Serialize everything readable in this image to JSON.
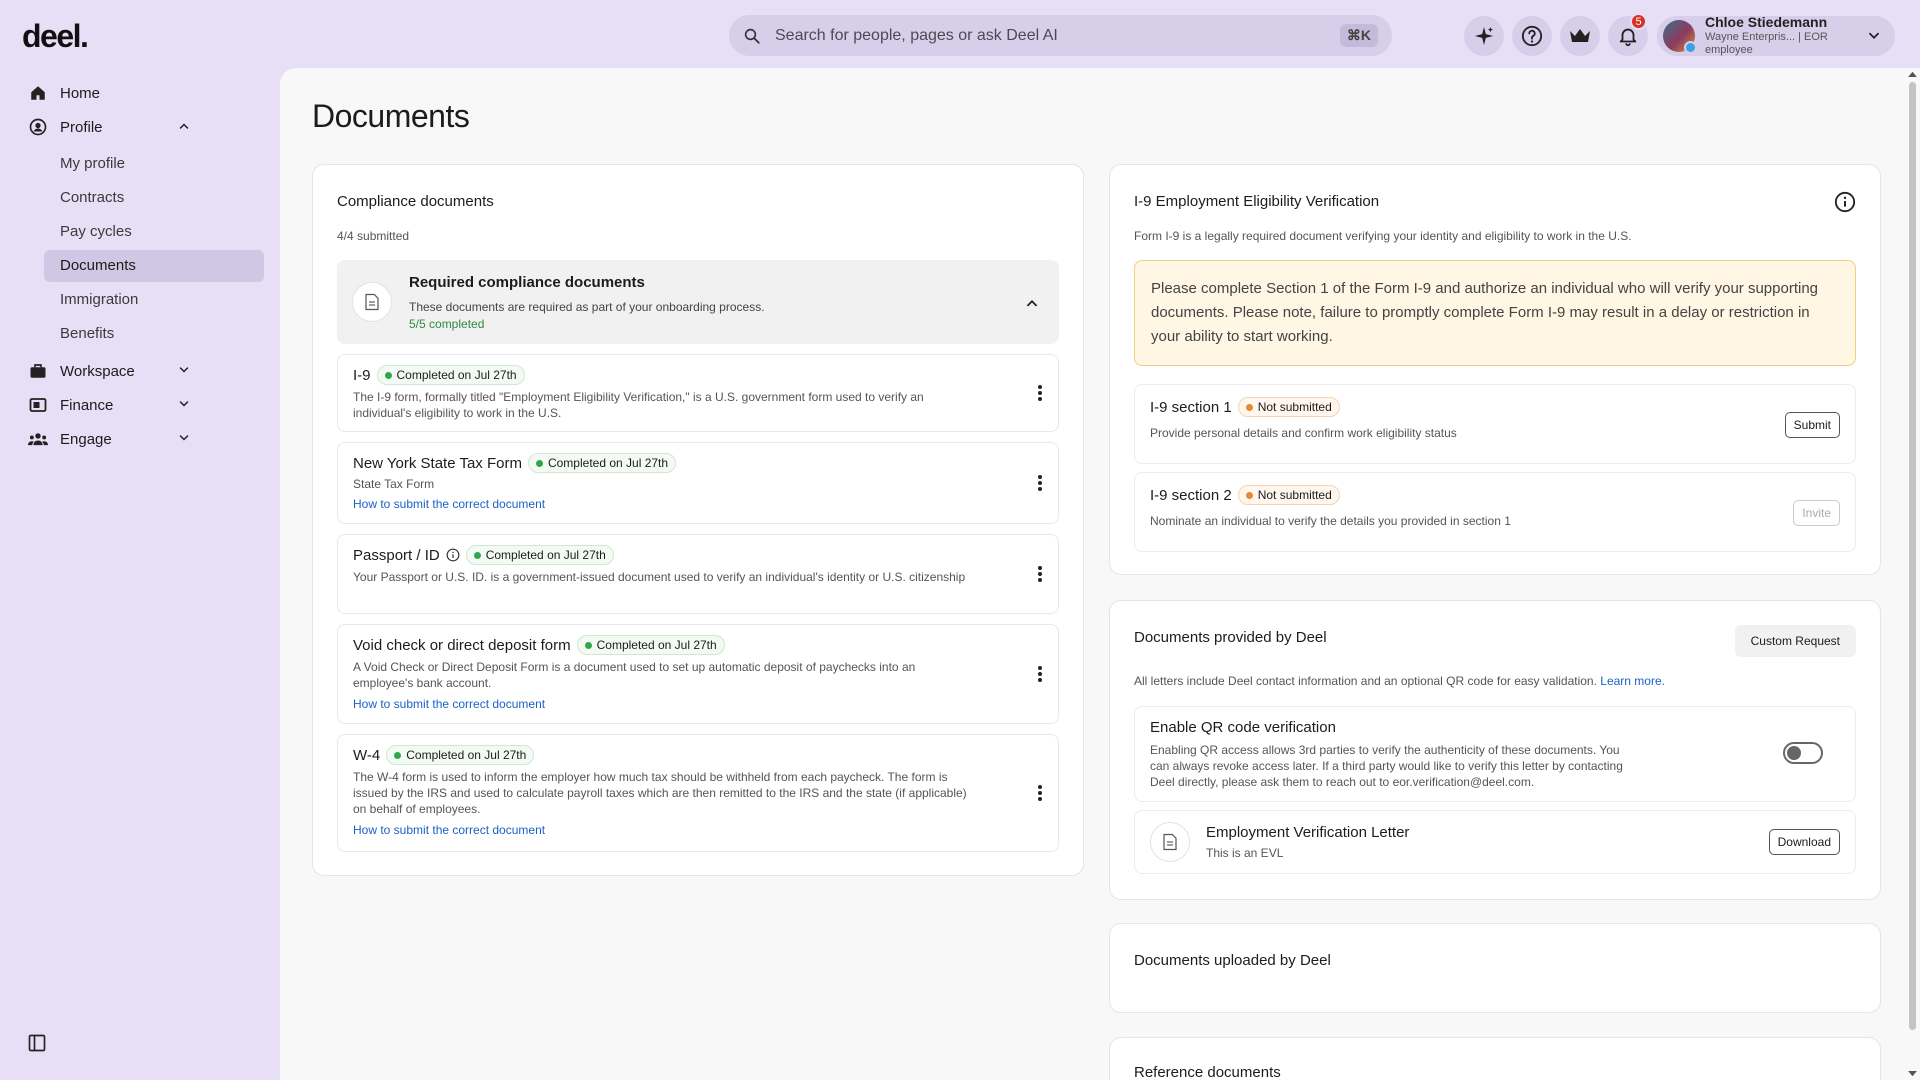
{
  "app": {
    "logo": "deel."
  },
  "search": {
    "placeholder": "Search for people, pages or ask Deel AI",
    "shortcut": "⌘K"
  },
  "topbar": {
    "notifications_count": "5"
  },
  "user": {
    "name": "Chloe Stiedemann",
    "subtitle": "Wayne Enterpris... | EOR employee"
  },
  "sidebar": {
    "home": "Home",
    "profile": "Profile",
    "profile_items": [
      "My profile",
      "Contracts",
      "Pay cycles",
      "Documents",
      "Immigration",
      "Benefits"
    ],
    "workspace": "Workspace",
    "finance": "Finance",
    "engage": "Engage"
  },
  "page": {
    "title": "Documents"
  },
  "compliance": {
    "title": "Compliance documents",
    "submitted": "4/4 submitted",
    "required_title": "Required compliance documents",
    "required_desc": "These documents are required as part of your onboarding process.",
    "required_status": "5/5 completed",
    "items": [
      {
        "name": "I-9",
        "status": "Completed on Jul 27th",
        "desc": "The I-9 form, formally titled \"Employment Eligibility Verification,\" is a U.S. government form used to verify an individual's eligibility to work in the U.S.",
        "link": ""
      },
      {
        "name": "New York State Tax Form",
        "status": "Completed on Jul 27th",
        "desc": "State Tax Form",
        "link": "How to submit the correct document"
      },
      {
        "name": "Passport / ID",
        "status": "Completed on Jul 27th",
        "desc": "Your Passport or U.S. ID. is a government-issued document used to verify an individual's identity or U.S. citizenship",
        "link": ""
      },
      {
        "name": "Void check or direct deposit form",
        "status": "Completed on Jul 27th",
        "desc": "A Void Check or Direct Deposit Form is a document used to set up automatic deposit of paychecks into an employee's bank account.",
        "link": "How to submit the correct document"
      },
      {
        "name": "W-4",
        "status": "Completed on Jul 27th",
        "desc": "The W-4 form is used to inform the employer how much tax should be withheld from each paycheck. The form is issued by the IRS and used to calculate payroll taxes which are then remitted to the IRS and the state (if applicable) on behalf of employees.",
        "link": "How to submit the correct document"
      }
    ]
  },
  "i9": {
    "title": "I-9 Employment Eligibility Verification",
    "desc": "Form I-9 is a legally required document verifying your identity and eligibility to work in the U.S.",
    "warning": "Please complete Section 1 of the Form I-9 and authorize an individual who will verify your supporting documents. Please note, failure to promptly complete Form I-9 may result in a delay or restriction in your ability to start working.",
    "sections": [
      {
        "name": "I-9 section 1",
        "status": "Not submitted",
        "desc": "Provide personal details and confirm work eligibility status",
        "button": "Submit"
      },
      {
        "name": "I-9 section 2",
        "status": "Not submitted",
        "desc": "Nominate an individual to verify the details you provided in section 1",
        "button": "Invite"
      }
    ]
  },
  "deel_docs": {
    "title": "Documents provided by Deel",
    "custom_request": "Custom Request",
    "desc": "All letters include Deel contact information and an optional QR code for easy validation.",
    "learn_more": "Learn more.",
    "qr_title": "Enable QR code verification",
    "qr_desc": "Enabling QR access allows 3rd parties to verify the authenticity of these documents. You can always revoke access later. If a third party would like to verify this letter by contacting Deel directly, please ask them to reach out to eor.verification@deel.com.",
    "qr_enabled": false,
    "evl_title": "Employment Verification Letter",
    "evl_sub": "This is an EVL",
    "download": "Download"
  },
  "uploaded": {
    "title": "Documents uploaded by Deel"
  },
  "reference": {
    "title": "Reference documents"
  }
}
